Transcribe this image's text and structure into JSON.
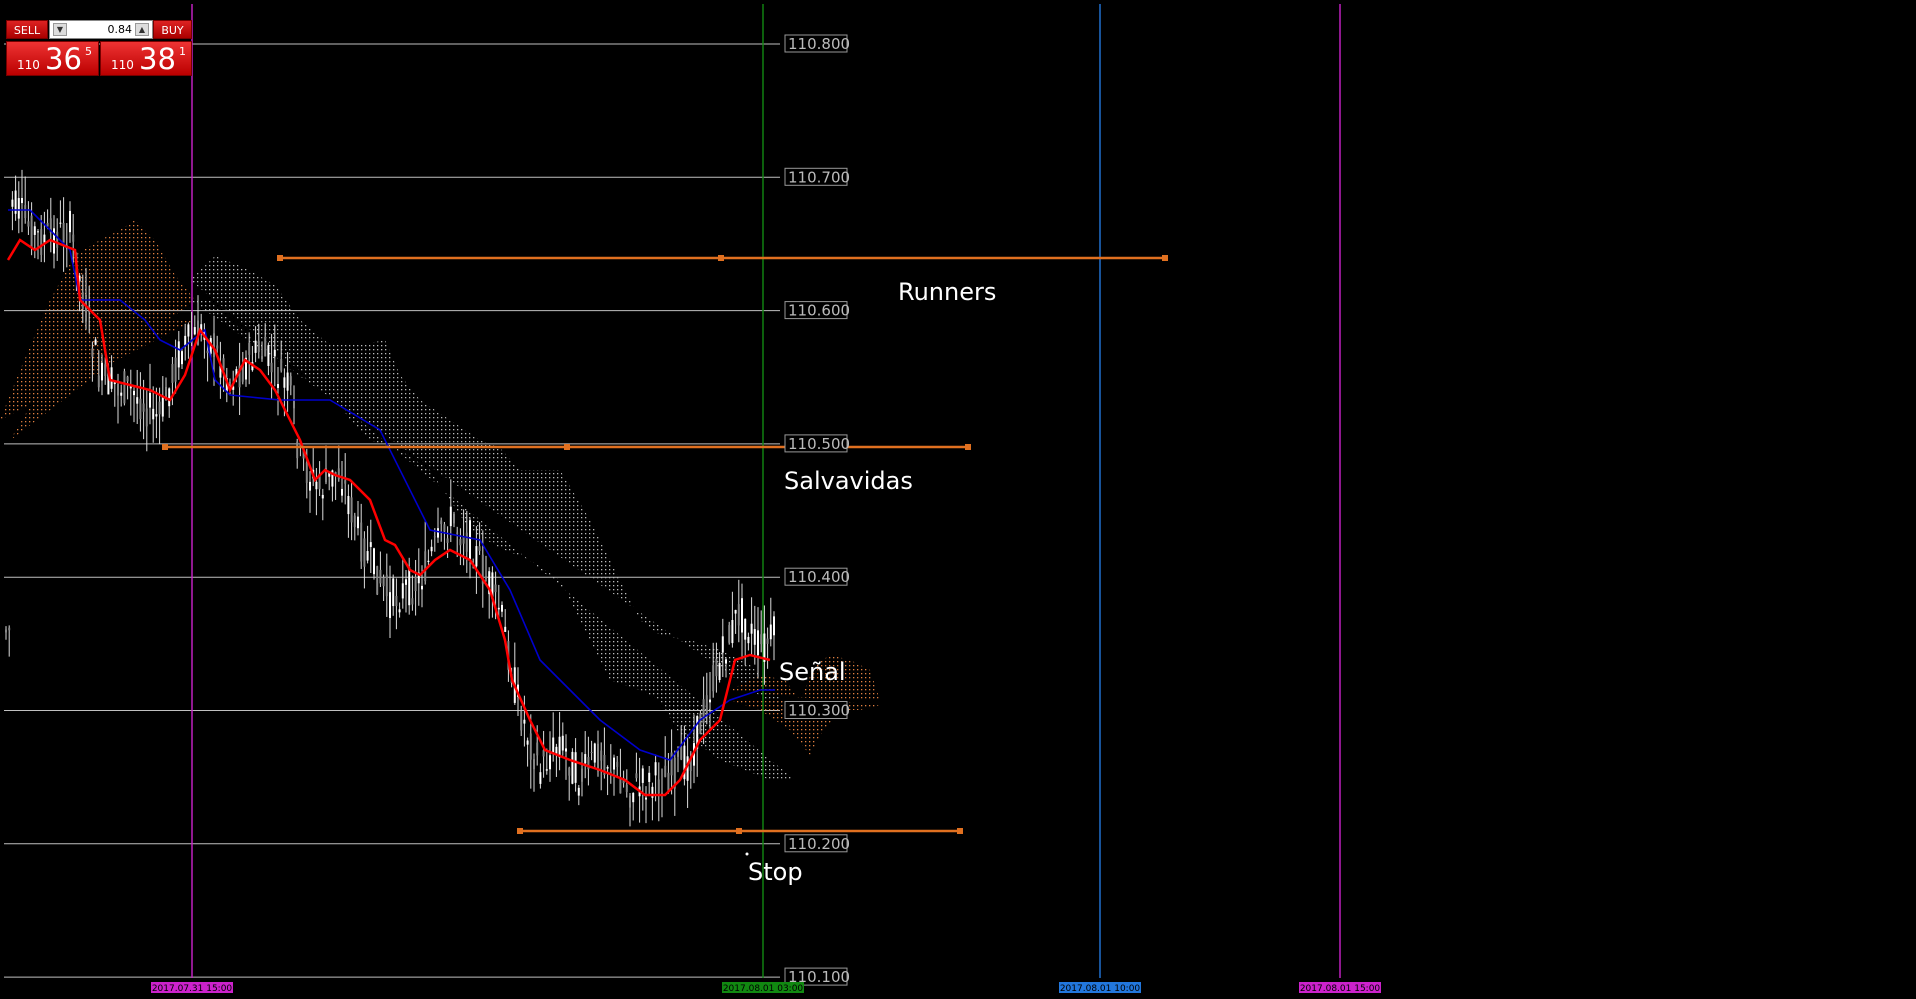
{
  "trade_panel": {
    "sell_label": "SELL",
    "buy_label": "BUY",
    "lot_value": "0.84",
    "lot_down_icon": "chevron-down-icon",
    "lot_up_icon": "chevron-up-icon",
    "sell_price": {
      "prefix": "110",
      "big": "36",
      "sup": "5"
    },
    "buy_price": {
      "prefix": "110",
      "big": "38",
      "sup": "1"
    }
  },
  "price_axis": {
    "levels": [
      "110.800",
      "110.700",
      "110.600",
      "110.500",
      "110.400",
      "110.300",
      "110.200",
      "110.100"
    ]
  },
  "time_markers": [
    {
      "label": "2017.07.31 15:00",
      "color": "#cc22cc"
    },
    {
      "label": "2017.08.01 03:00",
      "color": "#118811"
    },
    {
      "label": "2017.08.01 10:00",
      "color": "#2277dd"
    },
    {
      "label": "2017.08.01 15:00",
      "color": "#cc22cc"
    }
  ],
  "annotations": {
    "runners": "Runners",
    "salvavidas": "Salvavidas",
    "senal": "Señal",
    "stop": "Stop"
  },
  "colors": {
    "background": "#000000",
    "grid": "#c0c0c0",
    "tenkan": "#ff0000",
    "kijun": "#0000cc",
    "cloud_bull": "#e08040",
    "cloud_bear": "#bbbbbb",
    "levels": "#e07020"
  },
  "chart_data": {
    "type": "candlestick",
    "symbol_price_range": [
      110.1,
      110.8
    ],
    "levels": {
      "runners": 110.638,
      "salvavidas": 110.498,
      "stop": 110.21
    },
    "series": [
      {
        "name": "tenkan",
        "values": [
          110.66,
          110.64,
          110.6,
          110.55,
          110.53,
          110.51,
          110.52,
          110.58,
          110.6,
          110.58,
          110.52,
          110.48,
          110.42,
          110.38,
          110.37,
          110.4,
          110.38,
          110.35,
          110.28,
          110.25,
          110.24,
          110.23,
          110.25,
          110.28,
          110.33,
          110.35,
          110.36
        ]
      },
      {
        "name": "kijun",
        "values": [
          110.68,
          110.66,
          110.62,
          110.6,
          110.58,
          110.55,
          110.55,
          110.55,
          110.56,
          110.53,
          110.51,
          110.49,
          110.46,
          110.42,
          110.41,
          110.4,
          110.36,
          110.33,
          110.31,
          110.27,
          110.25,
          110.24,
          110.25,
          110.28,
          110.31,
          110.33,
          110.33
        ]
      }
    ]
  }
}
